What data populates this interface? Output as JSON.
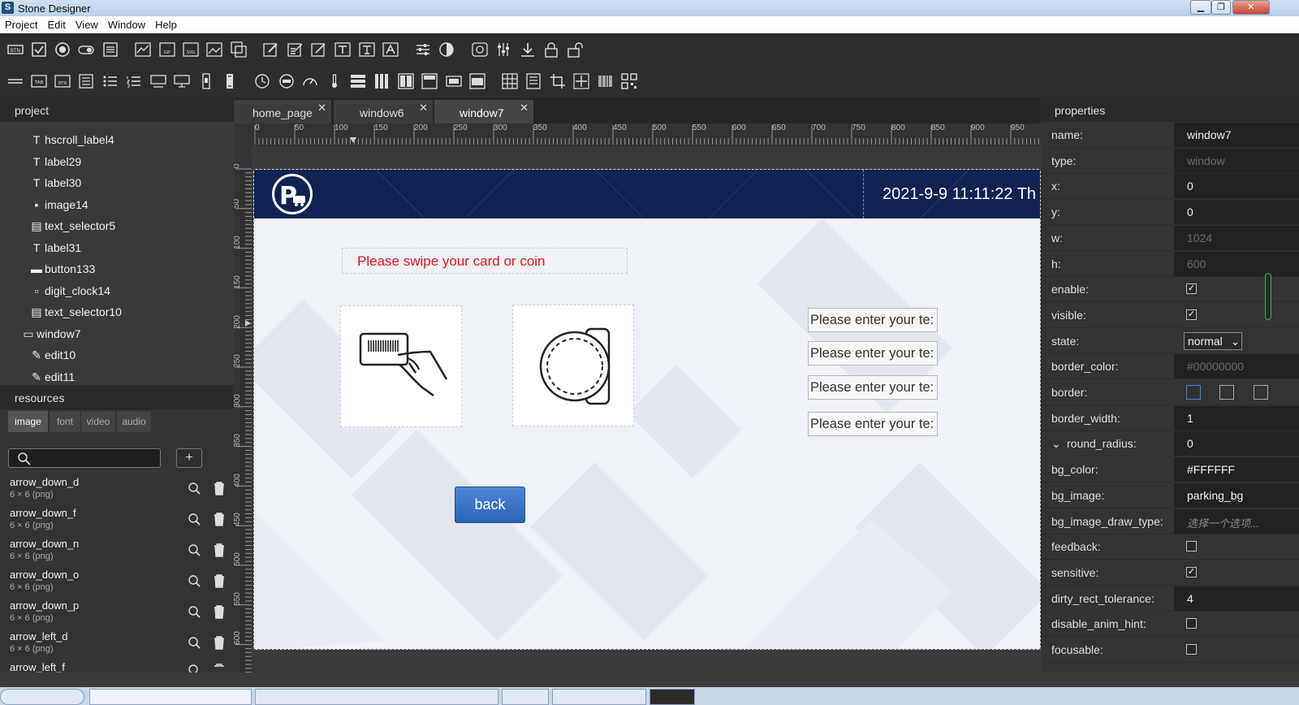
{
  "window": {
    "title": "Stone Designer",
    "minimize": "▁",
    "maximize": "❐",
    "close": "✕"
  },
  "menu": [
    "Project",
    "Edit",
    "View",
    "Window",
    "Help"
  ],
  "left": {
    "project_header": "project",
    "tree": [
      {
        "name": "hscroll_label4",
        "icon": "T",
        "icon_name": "hscroll-label-icon",
        "indent": 2
      },
      {
        "name": "label29",
        "icon": "T",
        "icon_name": "label-icon",
        "indent": 2
      },
      {
        "name": "label30",
        "icon": "T",
        "icon_name": "label-icon",
        "indent": 2
      },
      {
        "name": "image14",
        "icon": "▪",
        "icon_name": "image-icon",
        "indent": 2
      },
      {
        "name": "text_selector5",
        "icon": "▤",
        "icon_name": "text-selector-icon",
        "indent": 2
      },
      {
        "name": "label31",
        "icon": "T",
        "icon_name": "label-icon",
        "indent": 2
      },
      {
        "name": "button133",
        "icon": "▬",
        "icon_name": "button-icon",
        "indent": 2
      },
      {
        "name": "digit_clock14",
        "icon": "▫",
        "icon_name": "digit-clock-icon",
        "indent": 2
      },
      {
        "name": "text_selector10",
        "icon": "▤",
        "icon_name": "text-selector-icon",
        "indent": 2
      },
      {
        "name": "window7",
        "icon": "▭",
        "icon_name": "window-icon",
        "indent": 1
      },
      {
        "name": "edit10",
        "icon": "✎",
        "icon_name": "edit-icon",
        "indent": 2
      },
      {
        "name": "edit11",
        "icon": "✎",
        "icon_name": "edit-icon",
        "indent": 2
      }
    ],
    "resources_header": "resources",
    "res_tabs": [
      "image",
      "font",
      "video",
      "audio"
    ],
    "res_add": "+",
    "resources": [
      {
        "name": "arrow_down_d",
        "size": "6 × 6 (png)"
      },
      {
        "name": "arrow_down_f",
        "size": "6 × 6 (png)"
      },
      {
        "name": "arrow_down_n",
        "size": "6 × 6 (png)"
      },
      {
        "name": "arrow_down_o",
        "size": "6 × 6 (png)"
      },
      {
        "name": "arrow_down_p",
        "size": "6 × 6 (png)"
      },
      {
        "name": "arrow_left_d",
        "size": "6 × 6 (png)"
      },
      {
        "name": "arrow_left_f",
        "size": ""
      }
    ]
  },
  "tabs": [
    {
      "label": "home_page",
      "close": "✕",
      "active": false
    },
    {
      "label": "window6",
      "close": "✕",
      "active": false
    },
    {
      "label": "window7",
      "close": "✕",
      "active": true
    }
  ],
  "ruler_h": [
    "0",
    "50",
    "100",
    "150",
    "200",
    "250",
    "300",
    "350",
    "400",
    "450",
    "500",
    "550",
    "600",
    "650",
    "700",
    "750",
    "800",
    "850",
    "900",
    "950"
  ],
  "ruler_v": [
    "0",
    "50",
    "100",
    "150",
    "200",
    "250",
    "300",
    "350",
    "400",
    "450",
    "500",
    "550",
    "600"
  ],
  "design": {
    "datetime": "2021-9-9 11:11:22 Th",
    "swipe_label": "Please swipe your card or coin",
    "edits": [
      "Please enter your te:",
      "Please enter your te:",
      "Please enter your te:",
      "Please enter your te:"
    ],
    "back": "back",
    "colors": {
      "header": "#0f2352",
      "swipe_text": "#e3141a",
      "button": "#2a62b8"
    }
  },
  "props": {
    "header": "properties",
    "rows": [
      {
        "label": "name:",
        "kind": "text",
        "value": "window7"
      },
      {
        "label": "type:",
        "kind": "disabled",
        "value": "window"
      },
      {
        "label": "x:",
        "kind": "text",
        "value": "0"
      },
      {
        "label": "y:",
        "kind": "text",
        "value": "0"
      },
      {
        "label": "w:",
        "kind": "disabled",
        "value": "1024"
      },
      {
        "label": "h:",
        "kind": "disabled",
        "value": "600"
      },
      {
        "label": "enable:",
        "kind": "check",
        "checked": true
      },
      {
        "label": "visible:",
        "kind": "check",
        "checked": true
      },
      {
        "label": "state:",
        "kind": "select",
        "value": "normal"
      },
      {
        "label": "border_color:",
        "kind": "disabled",
        "value": "#00000000"
      },
      {
        "label": "border:",
        "kind": "border"
      },
      {
        "label": "border_width:",
        "kind": "text",
        "value": "1"
      },
      {
        "label": "round_radius:",
        "kind": "text",
        "value": "0",
        "expander": "⌄"
      },
      {
        "label": "bg_color:",
        "kind": "text",
        "value": "#FFFFFF"
      },
      {
        "label": "bg_image:",
        "kind": "text",
        "value": "parking_bg"
      },
      {
        "label": "bg_image_draw_type:",
        "kind": "placeholder",
        "value": "选择一个选项..."
      },
      {
        "label": "feedback:",
        "kind": "check",
        "checked": false
      },
      {
        "label": "sensitive:",
        "kind": "check",
        "checked": true
      },
      {
        "label": "dirty_rect_tolerance:",
        "kind": "text",
        "value": "4"
      },
      {
        "label": "disable_anim_hint:",
        "kind": "check",
        "checked": false
      },
      {
        "label": "focusable:",
        "kind": "check",
        "checked": false
      }
    ]
  }
}
